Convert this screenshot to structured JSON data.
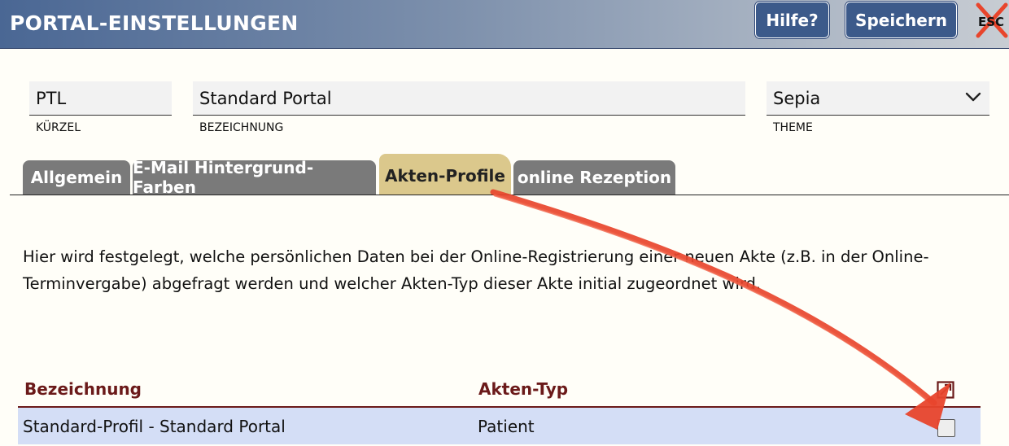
{
  "header": {
    "title": "PORTAL-EINSTELLUNGEN",
    "help_label": "Hilfe?",
    "save_label": "Speichern",
    "esc_label": "ESC"
  },
  "fields": {
    "kuerzel": {
      "value": "PTL",
      "label": "KÜRZEL"
    },
    "bezeichnung": {
      "value": "Standard Portal",
      "label": "BEZEICHNUNG"
    },
    "theme": {
      "value": "Sepia",
      "label": "THEME"
    }
  },
  "tabs": [
    {
      "label": "Allgemein",
      "active": false
    },
    {
      "label": "E-Mail Hintergrund-Farben",
      "active": false
    },
    {
      "label": "Akten-Profile",
      "active": true
    },
    {
      "label": "online Rezeption",
      "active": false
    }
  ],
  "description": "Hier wird festgelegt, welche persönlichen Daten bei der Online-Registrierung einer neuen Akte (z.B. in der Online-Terminvergabe) abgefragt werden und welcher Akten-Typ dieser Akte initial zugeordnet wird.",
  "table": {
    "headers": [
      "Bezeichnung",
      "Akten-Typ"
    ],
    "rows": [
      {
        "bezeichnung": "Standard-Profil - Standard Portal",
        "akten_typ": "Patient",
        "checked": false
      }
    ]
  },
  "colors": {
    "header_accent": "#4a6794",
    "active_tab": "#dbc88c",
    "inactive_tab": "#7a7a7a",
    "table_header_text": "#6b1a1a",
    "row_highlight": "#d4def6",
    "annotation": "#e8452c"
  },
  "icons": [
    "chevron-down-icon",
    "esc-close-icon",
    "edit-external-icon",
    "red-arrow-annotation"
  ]
}
